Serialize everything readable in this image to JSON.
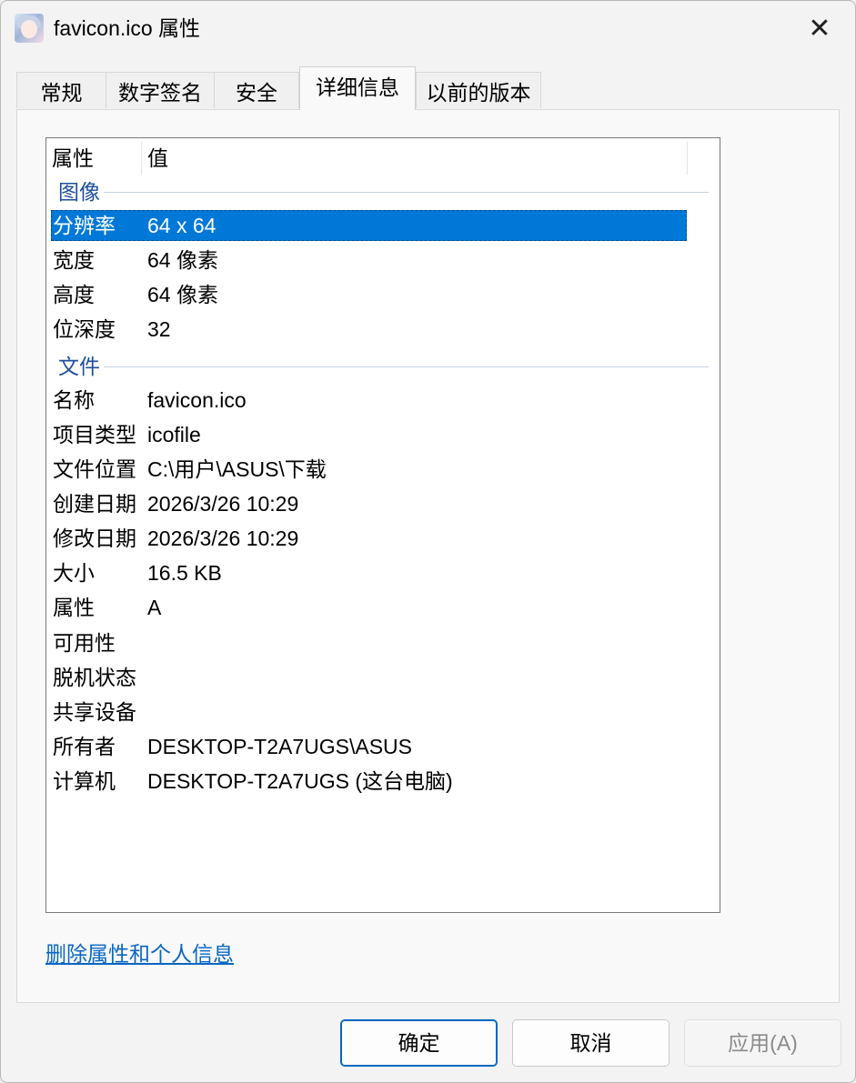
{
  "window": {
    "title": "favicon.ico 属性",
    "close_icon": "close-icon"
  },
  "tabs": [
    {
      "label": "常规",
      "active": false
    },
    {
      "label": "数字签名",
      "active": false
    },
    {
      "label": "安全",
      "active": false
    },
    {
      "label": "详细信息",
      "active": true
    },
    {
      "label": "以前的版本",
      "active": false
    }
  ],
  "details": {
    "columns": {
      "property": "属性",
      "value": "值"
    },
    "groups": [
      {
        "name": "图像",
        "rows": [
          {
            "name": "分辨率",
            "value": "64 x 64",
            "selected": true
          },
          {
            "name": "宽度",
            "value": "64 像素"
          },
          {
            "name": "高度",
            "value": "64 像素"
          },
          {
            "name": "位深度",
            "value": "32"
          }
        ]
      },
      {
        "name": "文件",
        "rows": [
          {
            "name": "名称",
            "value": "favicon.ico"
          },
          {
            "name": "项目类型",
            "value": "icofile"
          },
          {
            "name": "文件位置",
            "value": "C:\\用户\\ASUS\\下载"
          },
          {
            "name": "创建日期",
            "value": "2026/3/26 10:29"
          },
          {
            "name": "修改日期",
            "value": "2026/3/26 10:29"
          },
          {
            "name": "大小",
            "value": "16.5 KB"
          },
          {
            "name": "属性",
            "value": "A"
          },
          {
            "name": "可用性",
            "value": ""
          },
          {
            "name": "脱机状态",
            "value": ""
          },
          {
            "name": "共享设备",
            "value": ""
          },
          {
            "name": "所有者",
            "value": "DESKTOP-T2A7UGS\\ASUS"
          },
          {
            "name": "计算机",
            "value": "DESKTOP-T2A7UGS (这台电脑)"
          }
        ]
      }
    ]
  },
  "remove_link": "删除属性和个人信息",
  "buttons": {
    "ok": "确定",
    "cancel": "取消",
    "apply": "应用(A)"
  },
  "colors": {
    "selection": "#0078d7",
    "link": "#0a66c2",
    "group_header": "#1e4e9c"
  }
}
